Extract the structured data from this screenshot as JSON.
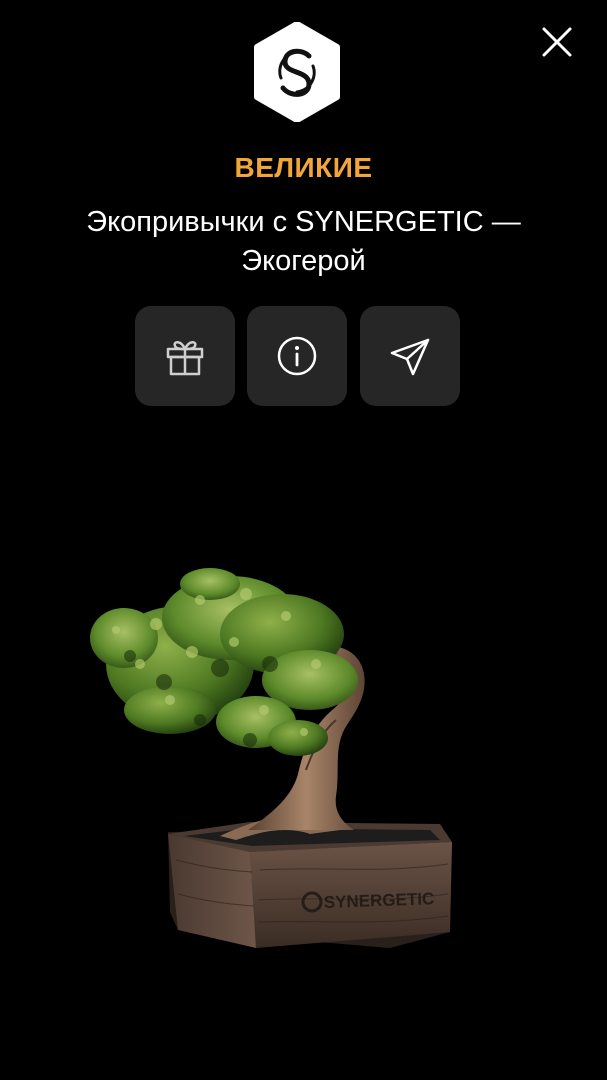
{
  "header": {
    "category": "ВЕЛИКИЕ",
    "title": "Экопривычки с SYNERGETIC — Экогерой"
  },
  "icons": {
    "close": "close-icon",
    "logo": "synergetic-logo",
    "gift": "gift-icon",
    "info": "info-icon",
    "share": "send-icon"
  },
  "model": {
    "description": "bonsai-tree-in-wooden-pot",
    "pot_brand": "SYNERGETIC"
  },
  "colors": {
    "background": "#000000",
    "accent": "#F2A63A",
    "button_bg": "#262626",
    "text": "#FFFFFF"
  }
}
